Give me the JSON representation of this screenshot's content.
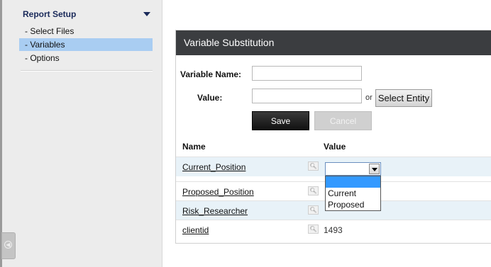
{
  "sidebar": {
    "header": "Report Setup",
    "items": [
      {
        "label": "- Select Files",
        "active": false
      },
      {
        "label": "- Variables",
        "active": true
      },
      {
        "label": "- Options",
        "active": false
      }
    ]
  },
  "panel": {
    "title": "Variable Substitution",
    "variable_name_label": "Variable Name:",
    "variable_name_value": "",
    "value_label": "Value:",
    "value_value": "",
    "or_text": "or",
    "select_entity_label": "Select Entity",
    "save_label": "Save",
    "cancel_label": "Cancel"
  },
  "table": {
    "headers": {
      "name": "Name",
      "value": "Value"
    },
    "rows": [
      {
        "name": "Current_Position",
        "value": ""
      },
      {
        "name": "Proposed_Position",
        "value": ""
      },
      {
        "name": "Risk_Researcher",
        "value": ""
      },
      {
        "name": "clientid",
        "value": "1493"
      }
    ]
  },
  "dropdown": {
    "selected": "",
    "options": [
      "",
      "Current",
      "Proposed"
    ]
  },
  "colors": {
    "header_bg": "#3b3d40",
    "active_item": "#a9cdf2",
    "row_alt": "#e8f2f8",
    "dropdown_highlight": "#3399ff"
  },
  "icons": [
    "magnifier-icon",
    "chevron-down-icon",
    "collapse-left-icon"
  ]
}
